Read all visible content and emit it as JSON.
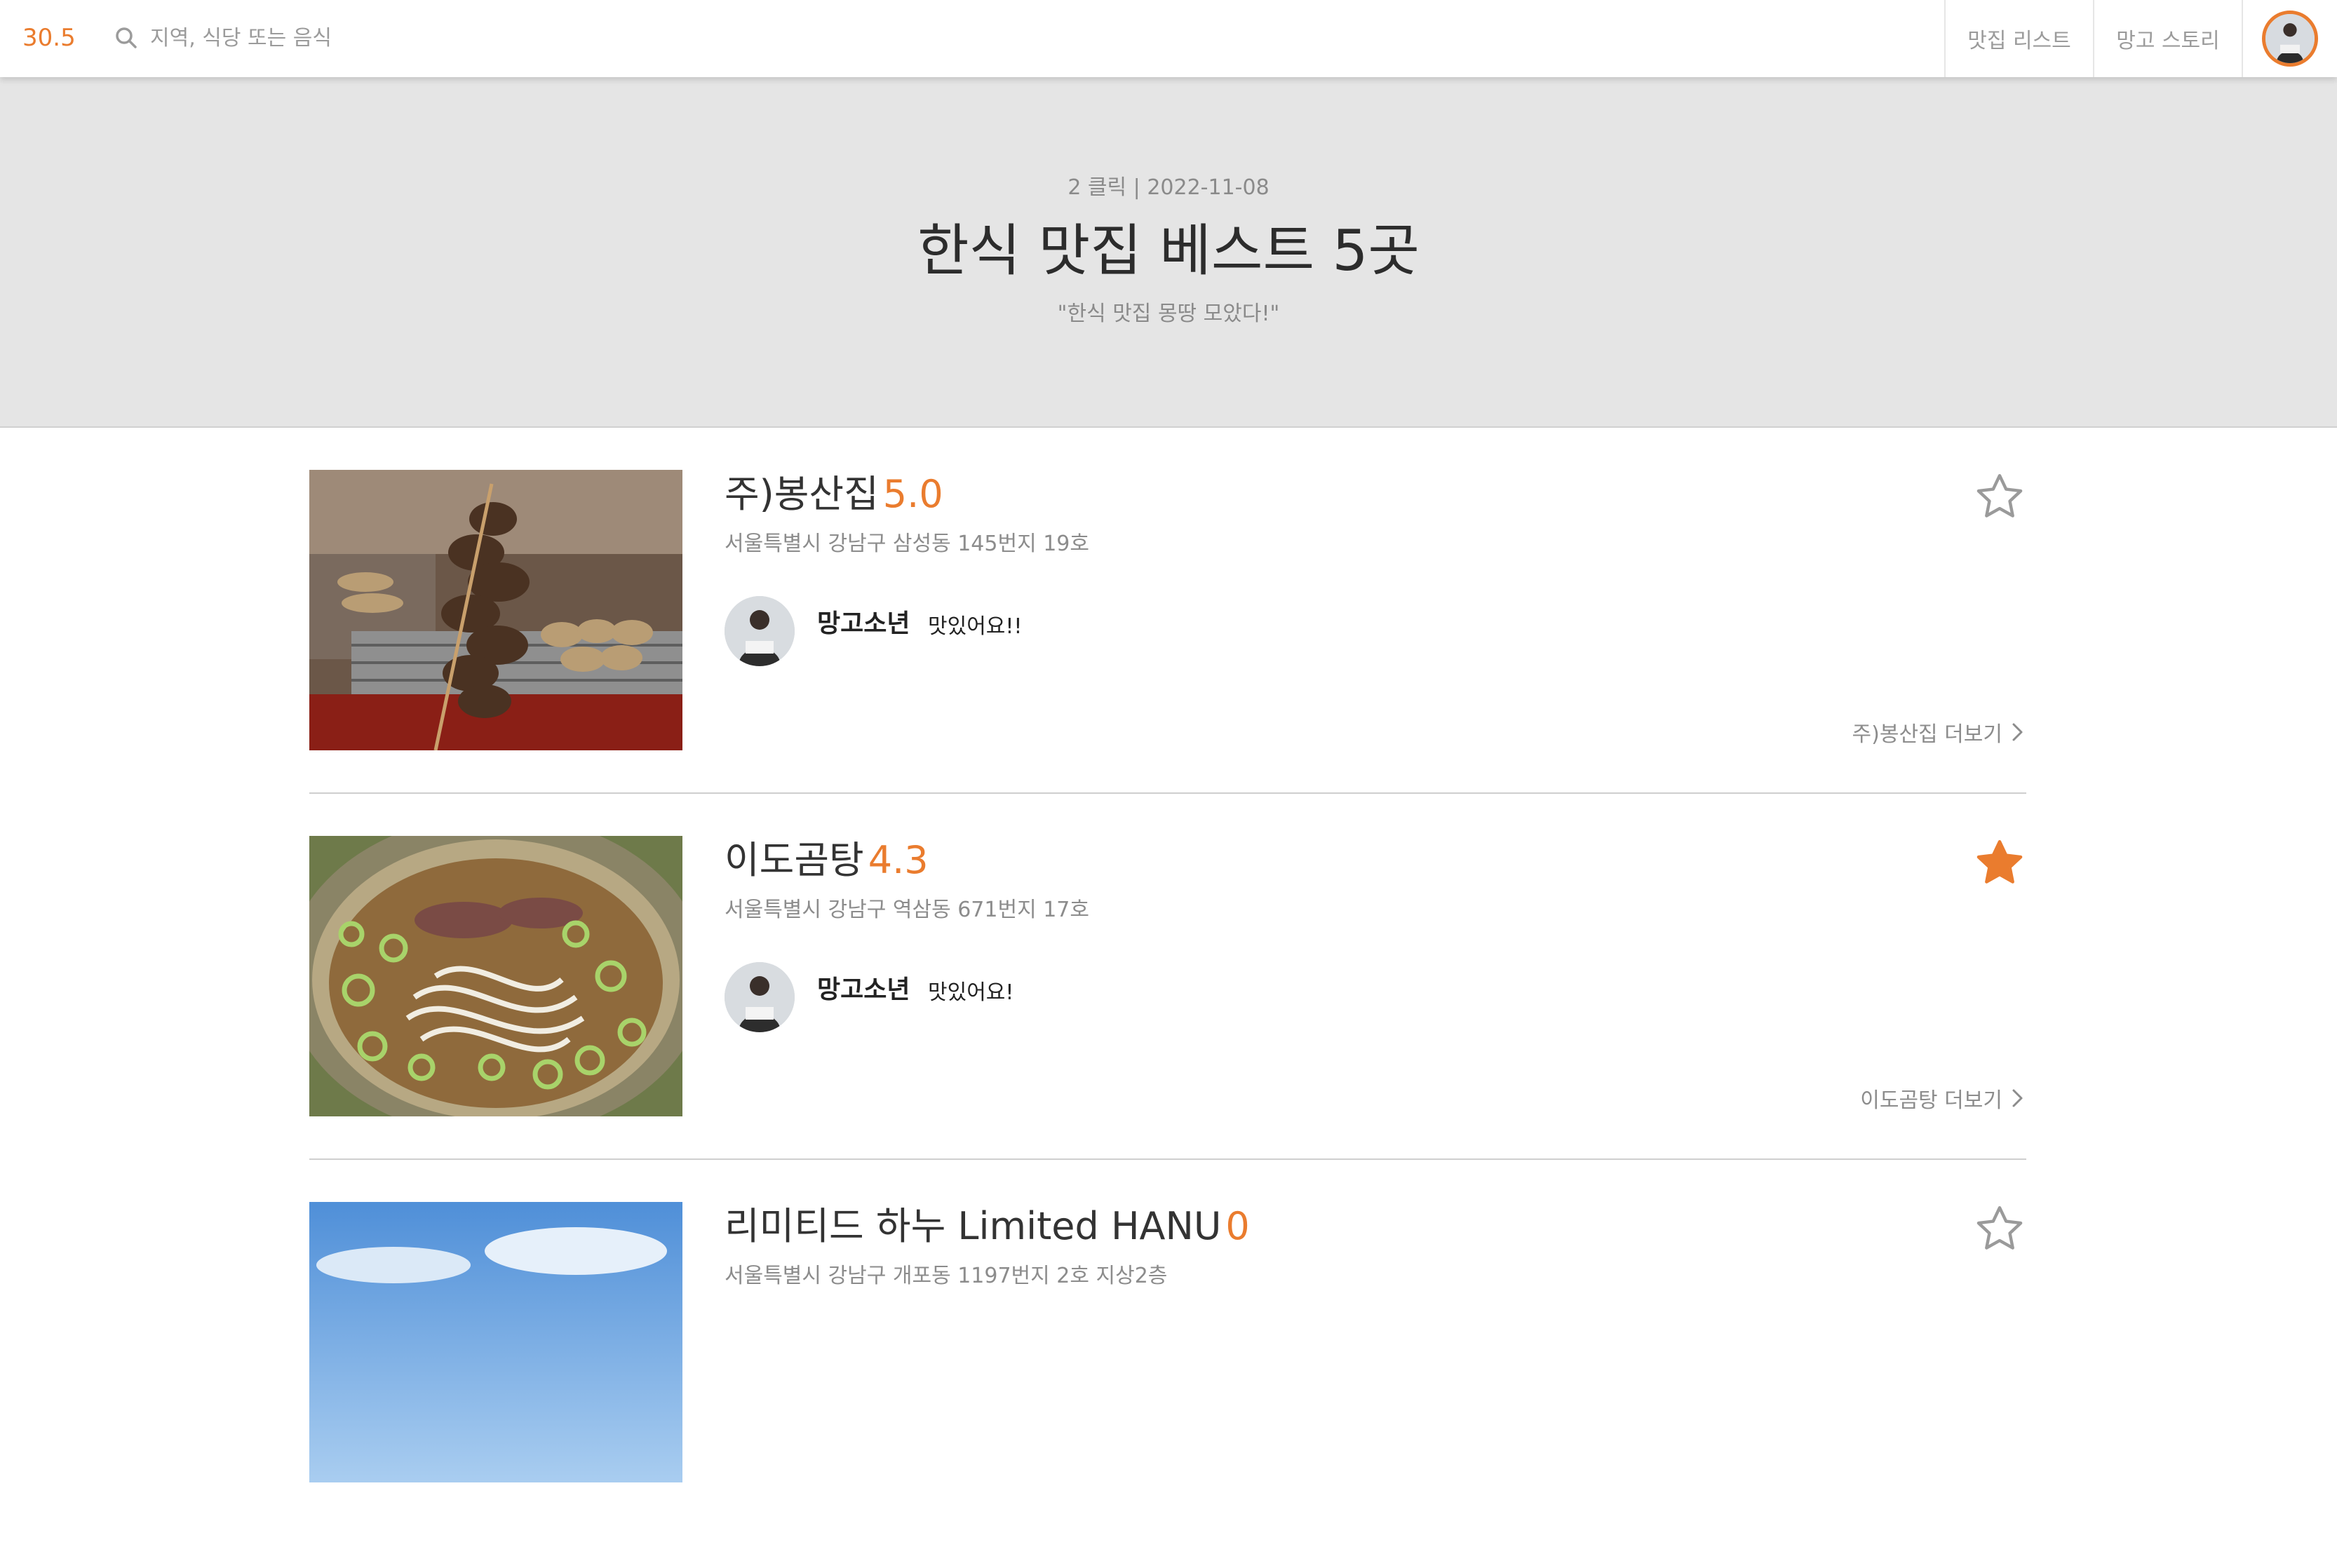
{
  "header": {
    "logo": "30.5",
    "search_placeholder": "지역, 식당 또는 음식",
    "nav": {
      "list_label": "맛집 리스트",
      "story_label": "망고 스토리"
    },
    "icons": {
      "search": "search-icon",
      "profile": "avatar"
    }
  },
  "banner": {
    "meta": "2 클릭 | 2022-11-08",
    "title": "한식 맛집 베스트 5곳",
    "subtitle": "\"한식 맛집 몽땅 모았다!\""
  },
  "colors": {
    "accent": "#ea7c2e",
    "banner_bg": "#e5e5e5",
    "muted_text": "#8c8c8c",
    "star_outline": "#9a9a9a"
  },
  "restaurants": [
    {
      "name": "주)봉산집",
      "score": "5.0",
      "address": "서울특별시 강남구 삼성동 145번지 19호",
      "reviewer": "망고소년",
      "comment": "맛있어요!!",
      "more_label": "주)봉산집 더보기",
      "favorited": false,
      "image": "grilled-skewers"
    },
    {
      "name": "이도곰탕",
      "score": "4.3",
      "address": "서울특별시 강남구 역삼동 671번지 17호",
      "reviewer": "망고소년",
      "comment": "맛있어요!",
      "more_label": "이도곰탕 더보기",
      "favorited": true,
      "image": "gomtang-soup"
    },
    {
      "name": "리미티드 하누 Limited HANU",
      "score": "0",
      "address": "서울특별시 강남구 개포동 1197번지 2호 지상2층",
      "favorited": false,
      "image": "sky"
    }
  ]
}
